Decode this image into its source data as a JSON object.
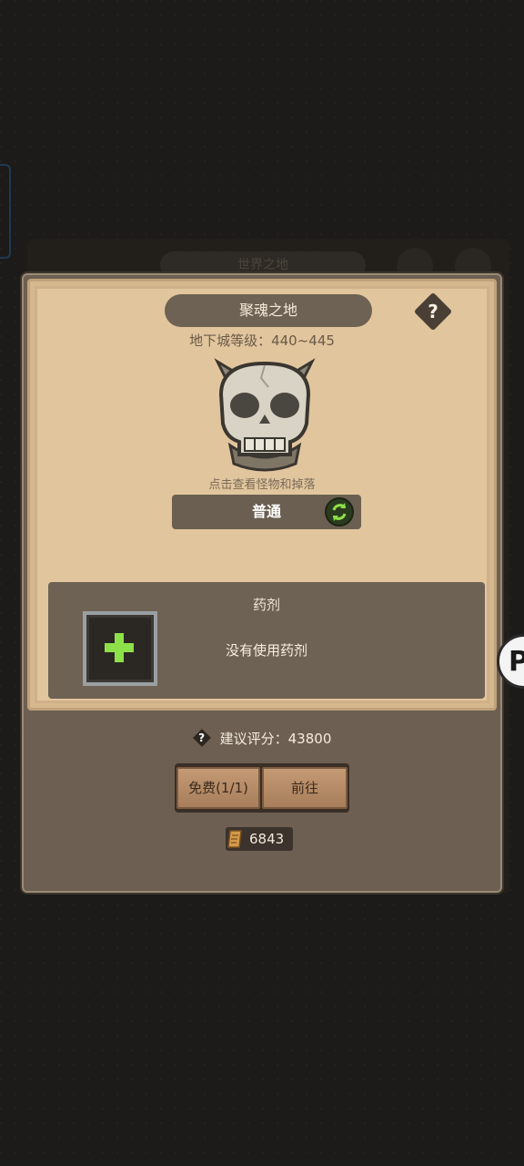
{
  "background": {
    "title": "世界之地"
  },
  "modal": {
    "title": "聚魂之地",
    "help_icon": "question-icon",
    "help_glyph": "?",
    "dungeon_level": "地下城等级：440~445",
    "monster_hint": "点击查看怪物和掉落",
    "difficulty": {
      "label": "普通",
      "switch_icon": "refresh-arrows-icon"
    },
    "potion": {
      "title": "药剂",
      "empty_text": "没有使用药剂",
      "add_icon": "plus-icon"
    },
    "rating": {
      "help_glyph": "?",
      "text": "建议评分：43800"
    },
    "buttons": {
      "free_label": "免费(1/1)",
      "go_label": "前往"
    },
    "currency": {
      "icon": "scroll-ticket-icon",
      "value": "6843"
    }
  },
  "side_float": {
    "letter": "P"
  },
  "colors": {
    "panel_dark": "#6d5f51",
    "panel_light": "#e1c59d",
    "accent_green": "#8ee04a",
    "wood": "#b78b65"
  }
}
